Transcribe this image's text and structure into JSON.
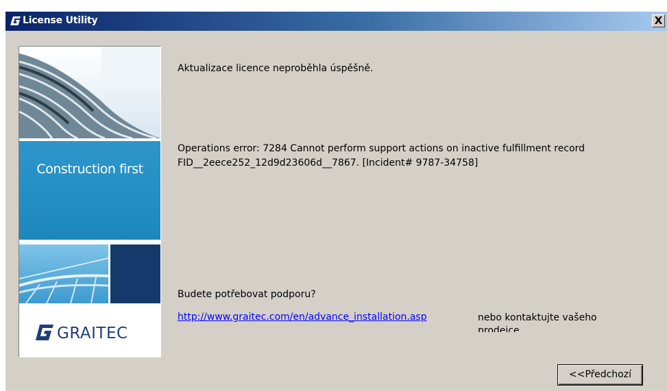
{
  "window": {
    "title": "License Utility",
    "close_label": "X"
  },
  "side_panel": {
    "slogan": "Construction first",
    "logo_text": "GRAITEC"
  },
  "content": {
    "status_message": "Aktualizace licence neproběhla úspěšně.",
    "error_message": "Operations error: 7284    Cannot perform support actions on inactive fulfillment record FID__2eece252_12d9d23606d__7867. [Incident# 9787-34758]",
    "support_question": "Budete potřebovat podporu?",
    "support_link": "http://www.graitec.com/en/advance_installation.asp",
    "contact_text": "nebo kontaktujte vašeho prodejce."
  },
  "buttons": {
    "back_label": "<<Předchozí"
  },
  "colors": {
    "titlebar_start": "#0a246a",
    "titlebar_end": "#a6caf0",
    "dialog_bg": "#d4d0c8",
    "link": "#0000ff",
    "slogan_band": "#2490c6",
    "logo_navy": "#1f3e78"
  },
  "icons": {
    "app": "graitec-g-icon",
    "close": "close-icon",
    "logo": "graitec-logo-mark"
  }
}
